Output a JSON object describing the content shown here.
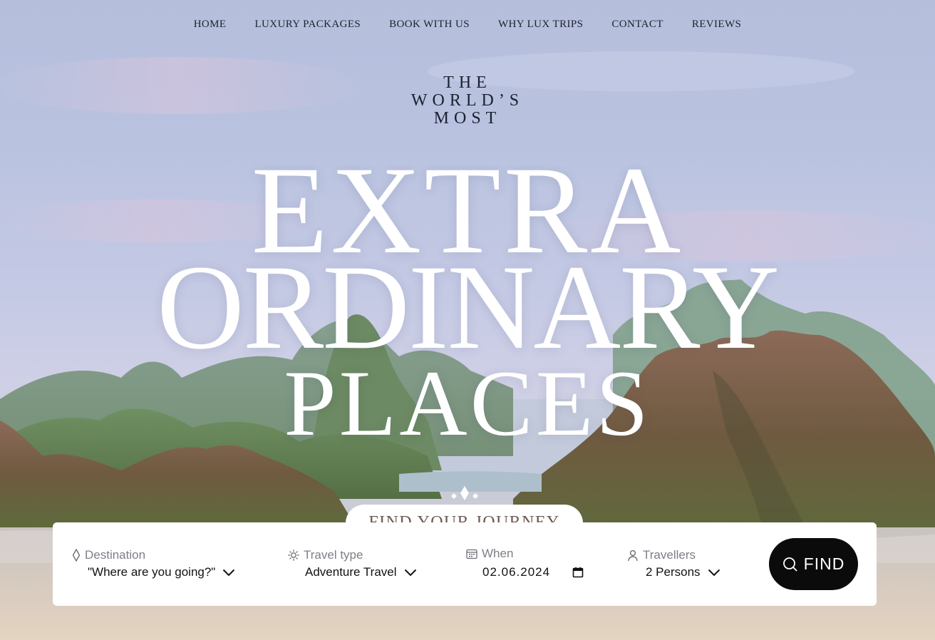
{
  "nav": {
    "items": [
      "HOME",
      "LUXURY PACKAGES",
      "BOOK WITH US",
      "WHY LUX TRIPS",
      "CONTACT",
      "REVIEWS"
    ]
  },
  "hero": {
    "kicker_line1": "THE",
    "kicker_line2": "WORLD’S",
    "kicker_line3": "MOST",
    "title_line1": "EXTRA",
    "title_line2": "ORDINARY",
    "title_line3": "PLACES"
  },
  "search": {
    "tab_label": "FIND YOUR JOURNEY",
    "destination": {
      "label": "Destination",
      "value": "\"Where are you going?\"",
      "icon": "diamond-icon"
    },
    "travel_type": {
      "label": "Travel type",
      "value": "Adventure Travel",
      "icon": "sun-icon"
    },
    "when": {
      "label": "When",
      "value": "02.06.2024",
      "icon": "calendar-icon"
    },
    "travellers": {
      "label": "Travellers",
      "value": "2 Persons",
      "icon": "person-icon"
    },
    "find_label": "FIND"
  },
  "colors": {
    "nav_text": "#1d2230",
    "title": "#ffffff",
    "tab_text": "#6b5a52",
    "button_bg": "#0b0b0c",
    "label_text": "#7c7f86"
  }
}
